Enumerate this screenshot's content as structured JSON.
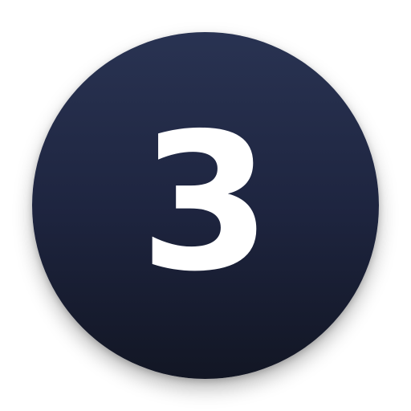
{
  "badge": {
    "number": "3",
    "colors": {
      "top": "#293352",
      "bottom": "#121624",
      "text": "#ffffff",
      "background": "#ffffff"
    }
  }
}
